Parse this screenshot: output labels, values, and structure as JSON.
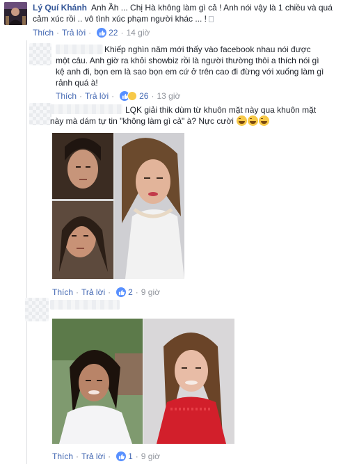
{
  "comment1": {
    "author": "Lý Quí Khánh",
    "text_line1": "Anh Ầh ... Chị Hà không làm gì cả ! Anh nói vậy là 1 chiều và quá",
    "text_line2": "cảm xúc rồi .. vô tình xúc phạm người khác ... !",
    "like_label": "Thích",
    "reply_label": "Trả lời",
    "reaction_count": "22",
    "time": "14 giờ"
  },
  "reply1": {
    "line1": "Khiếp nghìn năm mới thấy vào facebook nhau nói được",
    "line2": "một câu. Anh giờ ra khỏi showbiz rồi là người thường thôi a thích nói gì",
    "line3": "kệ anh đi, bọn em là sao bọn em cứ ở trên cao đi đừng với xuống làm gì",
    "line4": "rảnh quá à!",
    "like_label": "Thích",
    "reply_label": "Trả lời",
    "reaction_count": "26",
    "time": "13 giờ"
  },
  "reply2": {
    "line1": "LQK giải thik dùm từ khuôn mặt này qua khuôn mặt",
    "line2": "này mà dám tự tin \"không làm gì cả\" à? Nực cười",
    "like_label": "Thích",
    "reply_label": "Trả lời",
    "reaction_count": "2",
    "time": "9 giờ"
  },
  "reply3": {
    "like_label": "Thích",
    "reply_label": "Trả lời",
    "reaction_count": "1",
    "time": "9 giờ"
  },
  "colors": {
    "link": "#365899",
    "action": "#4267b2",
    "meta": "#90949c",
    "like_blue": "#5890ff",
    "haha_yellow": "#f7c948"
  }
}
